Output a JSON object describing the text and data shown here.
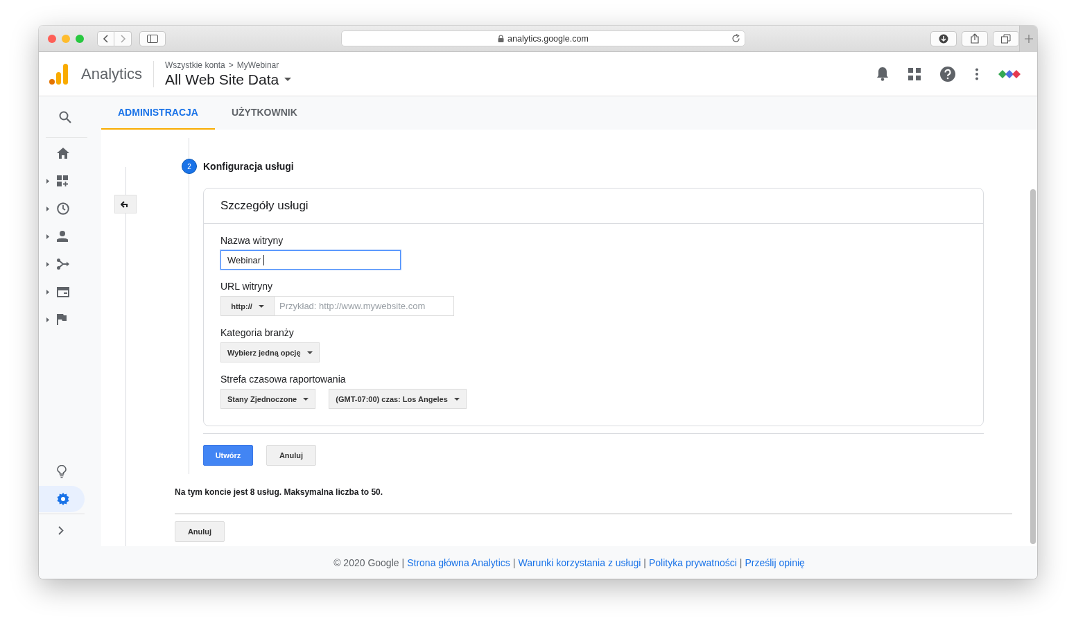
{
  "browser": {
    "url": "analytics.google.com"
  },
  "header": {
    "product": "Analytics",
    "breadcrumb": [
      "Wszystkie konta",
      "MyWebinar"
    ],
    "breadcrumb_separator": ">",
    "view": "All Web Site Data"
  },
  "tabs": [
    {
      "label": "ADMINISTRACJA",
      "selected": true
    },
    {
      "label": "UŻYTKOWNIK",
      "selected": false
    }
  ],
  "sidebar": {
    "nav": [
      {
        "expandable": false
      },
      {
        "expandable": true
      },
      {
        "expandable": true
      },
      {
        "expandable": true
      },
      {
        "expandable": true
      },
      {
        "expandable": true
      },
      {
        "expandable": true
      }
    ],
    "tools": [
      {
        "selected": false
      },
      {
        "selected": true
      }
    ]
  },
  "step": {
    "number": "2",
    "title": "Konfiguracja usługi"
  },
  "card": {
    "title": "Szczegóły usługi",
    "fields": [
      {
        "kind": "text",
        "label": "Nazwa witryny",
        "value": "Webinar",
        "focused": true
      },
      {
        "kind": "url",
        "label": "URL witryny",
        "protocol": "http://",
        "placeholder": "Przykład: http://www.mywebsite.com"
      },
      {
        "kind": "select",
        "label": "Kategoria branży",
        "options": [
          "Wybierz jedną opcję"
        ]
      },
      {
        "kind": "select",
        "label": "Strefa czasowa raportowania",
        "options": [
          "Stany Zjednoczone",
          "(GMT-07:00) czas: Los Angeles"
        ]
      }
    ]
  },
  "actions": [
    {
      "label": "Utwórz",
      "kind": "primary"
    },
    {
      "label": "Anuluj",
      "kind": "secondary"
    }
  ],
  "note": "Na tym koncie jest 8 usług. Maksymalna liczba to 50.",
  "bottom_button": "Anuluj",
  "footer": {
    "separator": "|",
    "items": [
      {
        "kind": "text",
        "text": "© 2020 Google"
      },
      {
        "kind": "link",
        "text": "Strona główna Analytics"
      },
      {
        "kind": "link",
        "text": "Warunki korzystania z usługi"
      },
      {
        "kind": "link",
        "text": "Polityka prywatności"
      },
      {
        "kind": "link",
        "text": "Prześlij opinię"
      }
    ]
  }
}
